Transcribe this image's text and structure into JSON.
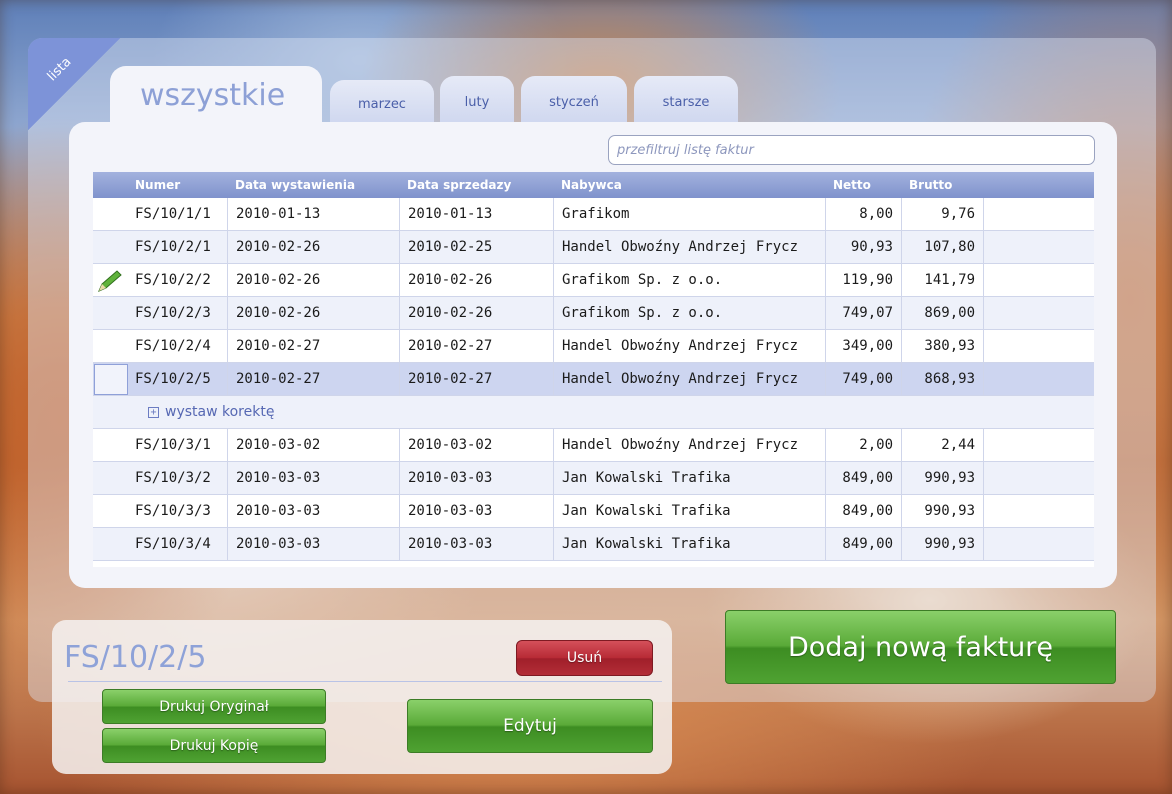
{
  "corner_label": "lista",
  "tabs": {
    "active": "wszystkie",
    "items": [
      "marzec",
      "luty",
      "styczeń",
      "starsze"
    ]
  },
  "filter": {
    "placeholder": "przefiltruj listę faktur"
  },
  "table": {
    "headers": [
      "Numer",
      "Data wystawienia",
      "Data sprzedazy",
      "Nabywca",
      "Netto",
      "Brutto"
    ],
    "rows": [
      [
        "FS/10/1/1",
        "2010-01-13",
        "2010-01-13",
        "Grafikom",
        "8,00",
        "9,76"
      ],
      [
        "FS/10/2/1",
        "2010-02-26",
        "2010-02-25",
        "Handel Obwoźny Andrzej Frycz",
        "90,93",
        "107,80"
      ],
      [
        "FS/10/2/2",
        "2010-02-26",
        "2010-02-26",
        "Grafikom Sp. z o.o.",
        "119,90",
        "141,79"
      ],
      [
        "FS/10/2/3",
        "2010-02-26",
        "2010-02-26",
        "Grafikom Sp. z o.o.",
        "749,07",
        "869,00"
      ],
      [
        "FS/10/2/4",
        "2010-02-27",
        "2010-02-27",
        "Handel Obwoźny Andrzej Frycz",
        "349,00",
        "380,93"
      ],
      [
        "FS/10/2/5",
        "2010-02-27",
        "2010-02-27",
        "Handel Obwoźny Andrzej Frycz",
        "749,00",
        "868,93"
      ],
      [
        "FS/10/3/1",
        "2010-03-02",
        "2010-03-02",
        "Handel Obwoźny Andrzej Frycz",
        "2,00",
        "2,44"
      ],
      [
        "FS/10/3/2",
        "2010-03-03",
        "2010-03-03",
        "Jan Kowalski Trafika",
        "849,00",
        "990,93"
      ],
      [
        "FS/10/3/3",
        "2010-03-03",
        "2010-03-03",
        "Jan Kowalski Trafika",
        "849,00",
        "990,93"
      ],
      [
        "FS/10/3/4",
        "2010-03-03",
        "2010-03-03",
        "Jan Kowalski Trafika",
        "849,00",
        "990,93"
      ]
    ],
    "selected_row": 5,
    "edit_icon_row": 2,
    "correction_action": "wystaw korektę"
  },
  "detail": {
    "number": "FS/10/2/5",
    "delete_label": "Usuń",
    "print_original_label": "Drukuj Oryginał",
    "print_copy_label": "Drukuj Kopię",
    "edit_label": "Edytuj"
  },
  "add_invoice_label": "Dodaj nową fakturę",
  "colors": {
    "accent": "#8da0d6",
    "header": "#7f92cc",
    "green_button": "#5aaa38",
    "red_button": "#b72a35"
  }
}
